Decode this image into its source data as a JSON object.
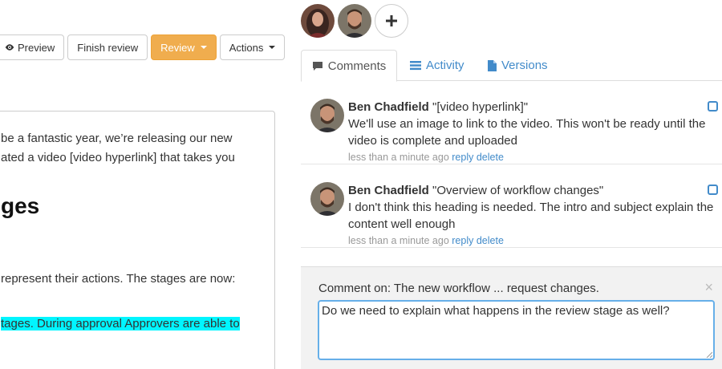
{
  "toolbar": {
    "preview_label": "Preview",
    "finish_review_label": "Finish review",
    "review_label": "Review",
    "actions_label": "Actions"
  },
  "document": {
    "line1": "be a fantastic year, we’re releasing our new",
    "line2": "ated a video [video hyperlink] that takes you",
    "heading": "ges",
    "line3": "represent their actions. The stages are now:",
    "highlighted": "tages. During approval Approvers are able to"
  },
  "tabs": [
    {
      "label": "Comments",
      "icon": "comment-icon"
    },
    {
      "label": "Activity",
      "icon": "list-icon"
    },
    {
      "label": "Versions",
      "icon": "file-icon"
    }
  ],
  "comments": [
    {
      "author": "Ben Chadfield",
      "quote": "\"[video hyperlink]\"",
      "body": "We'll use an image to link to the video. This won't be ready until the video is complete and uploaded",
      "time": "less than a minute ago",
      "reply": "reply",
      "delete": "delete"
    },
    {
      "author": "Ben Chadfield",
      "quote": "\"Overview of workflow changes\"",
      "body": "I don't think this heading is needed. The intro and subject explain the content well enough",
      "time": "less than a minute ago",
      "reply": "reply",
      "delete": "delete"
    }
  ],
  "reply_panel": {
    "title": "Comment on: The new workflow ... request changes.",
    "value": "Do we need to explain what happens in the review stage as well?",
    "close": "×"
  },
  "colors": {
    "accent": "#428bca",
    "review_button": "#f0ad4e",
    "highlight": "#00f5ff",
    "focus": "#66afe9"
  }
}
